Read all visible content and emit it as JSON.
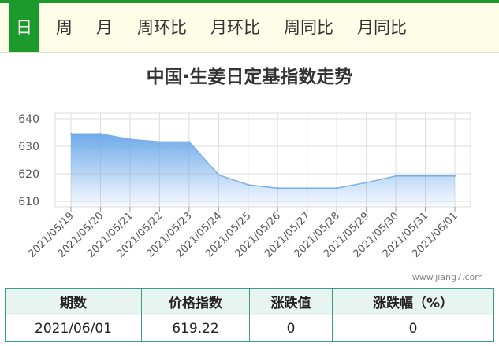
{
  "tabs": [
    {
      "label": "日",
      "active": true
    },
    {
      "label": "周",
      "active": false
    },
    {
      "label": "月",
      "active": false
    },
    {
      "label": "周环比",
      "active": false
    },
    {
      "label": "月环比",
      "active": false
    },
    {
      "label": "周同比",
      "active": false
    },
    {
      "label": "月同比",
      "active": false
    }
  ],
  "colors": {
    "accent": "#1c9a2c",
    "line": "#78aee8",
    "area_top": "#6eaaea",
    "grid": "#dcdcdc"
  },
  "chart_data": {
    "type": "area",
    "title": "中国·生姜日定基指数走势",
    "x": [
      "2021/05/19",
      "2021/05/20",
      "2021/05/21",
      "2021/05/22",
      "2021/05/23",
      "2021/05/24",
      "2021/05/25",
      "2021/05/26",
      "2021/05/27",
      "2021/05/28",
      "2021/05/29",
      "2021/05/30",
      "2021/05/31",
      "2021/06/01"
    ],
    "values": [
      634.5,
      634.5,
      632.5,
      631.6,
      631.6,
      619.6,
      616.0,
      614.8,
      614.8,
      614.8,
      616.8,
      619.2,
      619.22,
      619.22
    ],
    "yticks": [
      610,
      620,
      630,
      640
    ],
    "ylim": [
      608,
      642
    ],
    "grid": true
  },
  "watermark": "www.jiang7.com",
  "table": {
    "headers": [
      "期数",
      "价格指数",
      "涨跌值",
      "涨跌幅（%）"
    ],
    "row": [
      "2021/06/01",
      "619.22",
      "0",
      "0"
    ]
  }
}
